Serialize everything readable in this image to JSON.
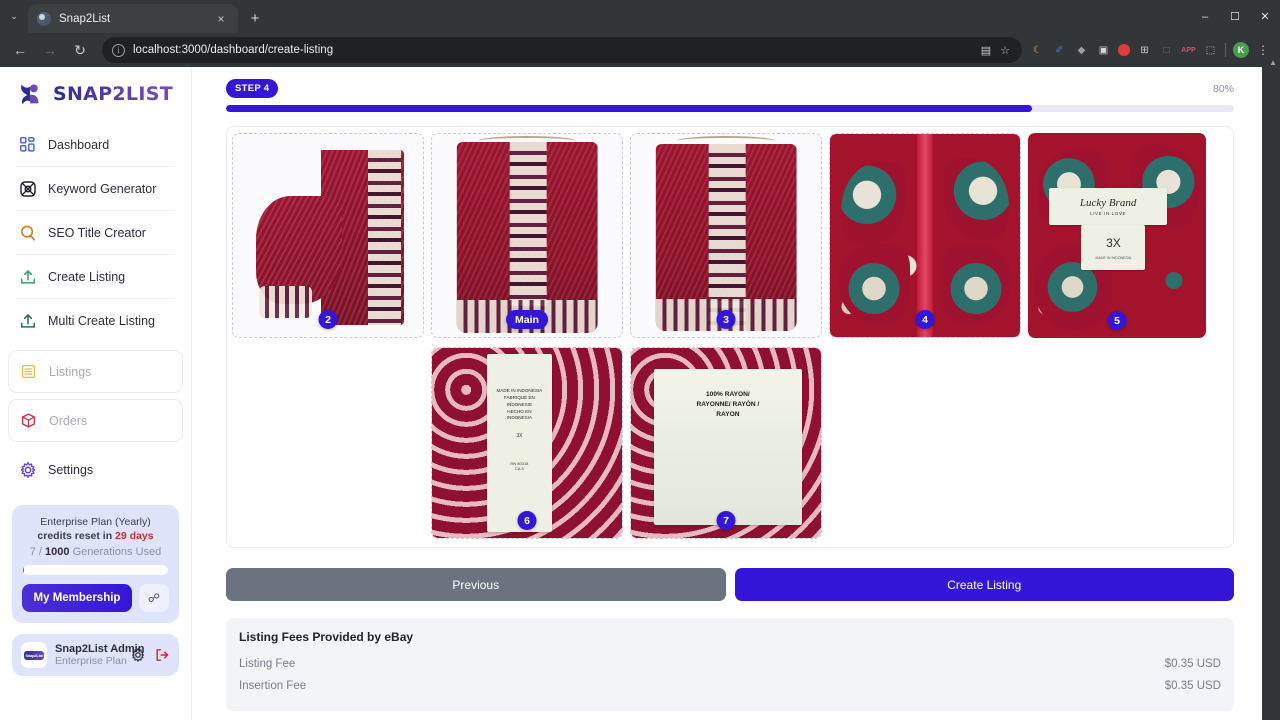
{
  "browser": {
    "tab": {
      "title": "Snap2List",
      "favicon": "globe-icon",
      "close": "×"
    },
    "new_tab": "+",
    "tab_menu": "⌄",
    "window": {
      "minimize": "‒",
      "maximize": "☐",
      "close": "✕"
    },
    "nav": {
      "back": "←",
      "forward": "→",
      "reload": "↻"
    },
    "omnibox": {
      "url": "localhost:3000/dashboard/create-listing",
      "info_icon": "ⓘ",
      "save_icon": "▤",
      "star_icon": "☆"
    },
    "extensions": [
      {
        "name": "extension-moon",
        "glyph": "☽",
        "color": "#e8a33d"
      },
      {
        "name": "extension-pen",
        "glyph": "✒",
        "color": "#4a74d6"
      },
      {
        "name": "extension-pin",
        "glyph": "⚙",
        "color": "#9aa0a6"
      },
      {
        "name": "extension-camera",
        "glyph": "▣",
        "color": "#d6d8db"
      },
      {
        "name": "extension-record",
        "glyph": "●",
        "color": "#e03b3b"
      },
      {
        "name": "extension-grid",
        "glyph": "⊞",
        "color": "#c8cacd"
      },
      {
        "name": "extension-dashed",
        "glyph": "□",
        "color": "#6e7275"
      },
      {
        "name": "extension-app",
        "glyph": "APP",
        "color": "#e0476a"
      },
      {
        "name": "extension-puzzle",
        "glyph": "⬚",
        "color": "#c8cacd"
      }
    ],
    "profile_initial": "K",
    "menu": "⋮"
  },
  "sidebar": {
    "logo": {
      "mark": "snap2list-logo-mark",
      "text": "SNAP2LIST"
    },
    "items": [
      {
        "label": "Dashboard",
        "icon": "grid-icon",
        "color": "#4a63d6",
        "boxed": false
      },
      {
        "label": "Keyword Generator",
        "icon": "atom-icon",
        "color": "#1d1d27",
        "boxed": false
      },
      {
        "label": "SEO Title Creator",
        "icon": "search-icon",
        "color": "#d07a28",
        "boxed": false
      },
      {
        "label": "Create Listing",
        "icon": "upload-icon",
        "color": "#3aa06a",
        "boxed": false
      },
      {
        "label": "Multi Create Listing",
        "icon": "upload-icon",
        "color": "#2b6f52",
        "boxed": false
      },
      {
        "label": "Listings",
        "icon": "list-icon",
        "color": "#e0c04a",
        "boxed": true
      },
      {
        "label": "Orders",
        "icon": "box-icon",
        "color": "#c0304a",
        "boxed": true
      },
      {
        "label": "Settings",
        "icon": "gear-icon",
        "color": "#6b3fd6",
        "boxed": false
      }
    ],
    "plan": {
      "name": "Enterprise Plan (Yearly)",
      "reset_prefix": "credits reset in ",
      "reset_days": "29 days",
      "used": "7",
      "separator": " / ",
      "total": "1000",
      "generations_label": " Generations Used",
      "progress_percent": 0.7,
      "membership_button": "My Membership",
      "link_icon": "link-icon"
    },
    "user": {
      "avatar_text": "Snap2List",
      "name": "Snap2List Admin",
      "plan": "Enterprise Plan",
      "settings_icon": "gear-icon",
      "logout_icon": "logout-icon"
    }
  },
  "main": {
    "step": {
      "badge": "STEP 4",
      "percent_label": "80%",
      "percent_value": 80
    },
    "images_row1": [
      {
        "badge": "2",
        "is_main": false,
        "kind": "garment-sleeve",
        "alt": "red paisley blouse sleeve detail"
      },
      {
        "badge": "Main",
        "is_main": true,
        "kind": "garment-hanger",
        "alt": "red paisley blouse on hanger front"
      },
      {
        "badge": "3",
        "is_main": false,
        "kind": "garment-hanger2",
        "alt": "red paisley blouse on hanger back"
      },
      {
        "badge": "4",
        "is_main": false,
        "kind": "paisley-closeup",
        "alt": "paisley fabric close-up"
      },
      {
        "badge": "5",
        "is_main": false,
        "kind": "brand-label",
        "alt": "Lucky Brand label size 3X"
      }
    ],
    "images_row2": [
      {
        "badge": "6",
        "is_main": false,
        "kind": "care-label-origin",
        "alt": "MADE IN INDONESIA care label"
      },
      {
        "badge": "7",
        "is_main": false,
        "kind": "care-label-fabric",
        "alt": "100% RAYON care label"
      }
    ],
    "image_text": {
      "brand_name": "Lucky Brand",
      "brand_tagline": "LIVE IN LOVE",
      "size": "3X",
      "made_in_usa": "MADE IN INDONESIA",
      "origin_lines": [
        "MADE IN INDONESIA",
        "FABRIQUE EN",
        "INDONESIE",
        "HECHO EN",
        "INDONESIA"
      ],
      "origin_size": "3X",
      "rn_line1": "RN 80318",
      "rn_line2": "CA 5",
      "fabric_lines": [
        "100% RAYON/",
        "RAYONNE/ RAYÓN /",
        "RAYON"
      ]
    },
    "buttons": {
      "previous": "Previous",
      "create": "Create Listing"
    },
    "fees": {
      "title": "Listing Fees Provided by eBay",
      "rows": [
        {
          "label": "Listing Fee",
          "value": "$0.35 USD"
        },
        {
          "label": "Insertion Fee",
          "value": "$0.35 USD"
        }
      ]
    }
  },
  "colors": {
    "accent": "#3416d8",
    "accent_soft": "#e9e7f8",
    "plan_bg": "#dfe3fb",
    "gray_button": "#6b7280",
    "danger": "#d02c2c"
  }
}
